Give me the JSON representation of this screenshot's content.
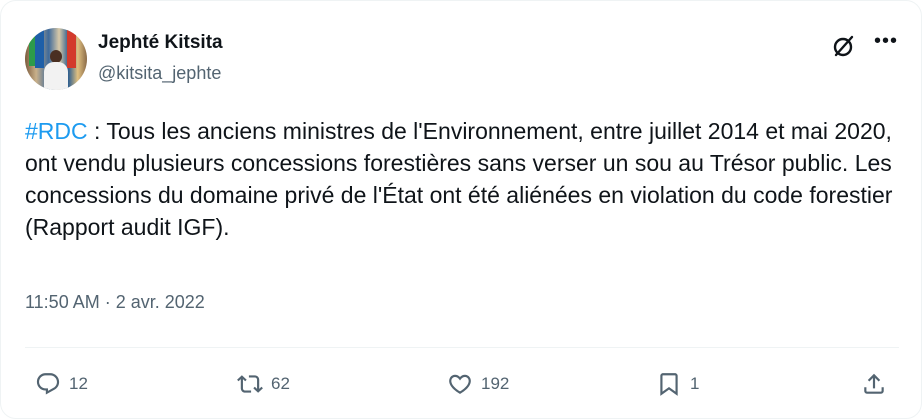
{
  "author": {
    "display_name": "Jephté Kitsita",
    "handle": "@kitsita_jephte"
  },
  "tweet": {
    "hashtag": "#RDC",
    "text": " : Tous les anciens ministres de l'Environnement, entre juillet 2014 et mai 2020, ont vendu plusieurs concessions forestières sans verser un sou au Trésor public. Les concessions du domaine privé de l'État ont été aliénées en violation du code forestier (Rapport audit IGF).",
    "time": "11:50 AM",
    "separator": "·",
    "date": "2 avr. 2022"
  },
  "actions": {
    "replies": "12",
    "reposts": "62",
    "likes": "192",
    "bookmarks": "1"
  },
  "icons": [
    "grok-icon",
    "more-icon",
    "reply-icon",
    "repost-icon",
    "like-icon",
    "bookmark-icon",
    "share-icon"
  ],
  "colors": {
    "text": "#0f1419",
    "secondary": "#536471",
    "accent": "#1d9bf0",
    "border": "#eff3f4"
  }
}
